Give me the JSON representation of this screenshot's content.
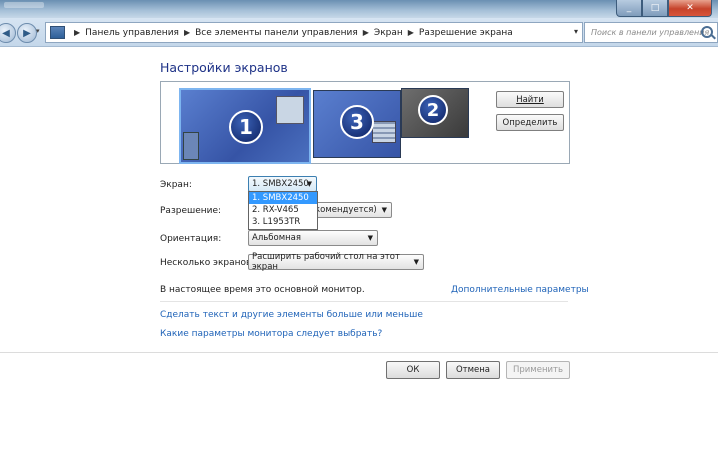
{
  "window": {
    "min": "_",
    "max": "□",
    "close": "✕"
  },
  "nav": {
    "back": "◀",
    "forward": "▶",
    "history": "▾",
    "breadcrumbs": [
      "Панель управления",
      "Все элементы панели управления",
      "Экран",
      "Разрешение экрана"
    ],
    "separator": "▶",
    "search_placeholder": "Поиск в панели управления",
    "address_dropdown": "▾",
    "refresh": "↻"
  },
  "page": {
    "title": "Настройки экранов"
  },
  "monitors": {
    "items": [
      "1",
      "3",
      "2"
    ],
    "find_button": "Найти",
    "identify_button": "Определить"
  },
  "form": {
    "screen_label": "Экран:",
    "screen_value": "1. SMBX2450",
    "screen_options": [
      "1. SMBX2450",
      "2. RX-V465",
      "3. L1953TR"
    ],
    "resolution_label": "Разрешение:",
    "resolution_value_visible": "комендуется)",
    "orientation_label": "Ориентация:",
    "orientation_value": "Альбомная",
    "multi_label": "Несколько экранов:",
    "multi_value": "Расширить рабочий стол на этот экран"
  },
  "info": {
    "main_monitor_text": "В настоящее время это основной монитор.",
    "advanced_link": "Дополнительные параметры",
    "text_size_link": "Сделать текст и другие элементы больше или меньше",
    "which_params_link": "Какие параметры монитора следует выбрать?"
  },
  "buttons": {
    "ok": "ОК",
    "cancel": "Отмена",
    "apply": "Применить"
  }
}
